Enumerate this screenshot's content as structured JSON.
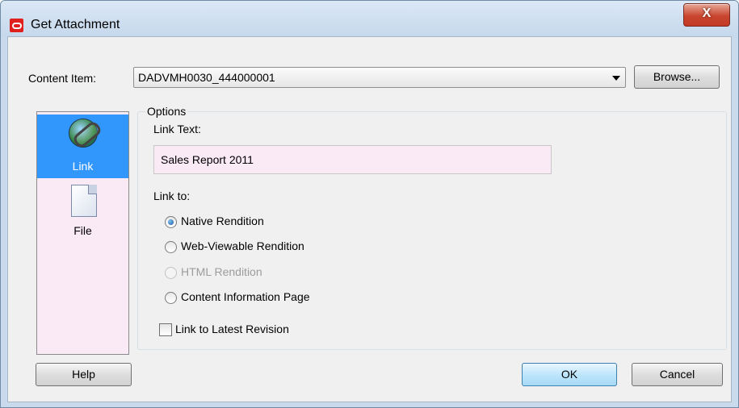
{
  "window": {
    "title": "Get Attachment",
    "close_label": "X"
  },
  "content_item": {
    "label": "Content Item:",
    "value": "DADVMH0030_444000001",
    "browse_label": "Browse..."
  },
  "sidebar": {
    "items": [
      {
        "label": "Link",
        "icon": "link-globe-icon",
        "selected": true
      },
      {
        "label": "File",
        "icon": "file-icon",
        "selected": false
      }
    ]
  },
  "options": {
    "group_title": "Options",
    "link_text_label": "Link Text:",
    "link_text_value": "Sales Report 2011",
    "link_to_label": "Link to:",
    "radios": [
      {
        "label": "Native Rendition",
        "checked": true,
        "enabled": true
      },
      {
        "label": "Web-Viewable Rendition",
        "checked": false,
        "enabled": true
      },
      {
        "label": "HTML Rendition",
        "checked": false,
        "enabled": false
      },
      {
        "label": "Content Information Page",
        "checked": false,
        "enabled": true
      }
    ],
    "latest_revision_label": "Link to Latest Revision",
    "latest_revision_checked": false
  },
  "buttons": {
    "help": "Help",
    "ok": "OK",
    "cancel": "Cancel"
  }
}
